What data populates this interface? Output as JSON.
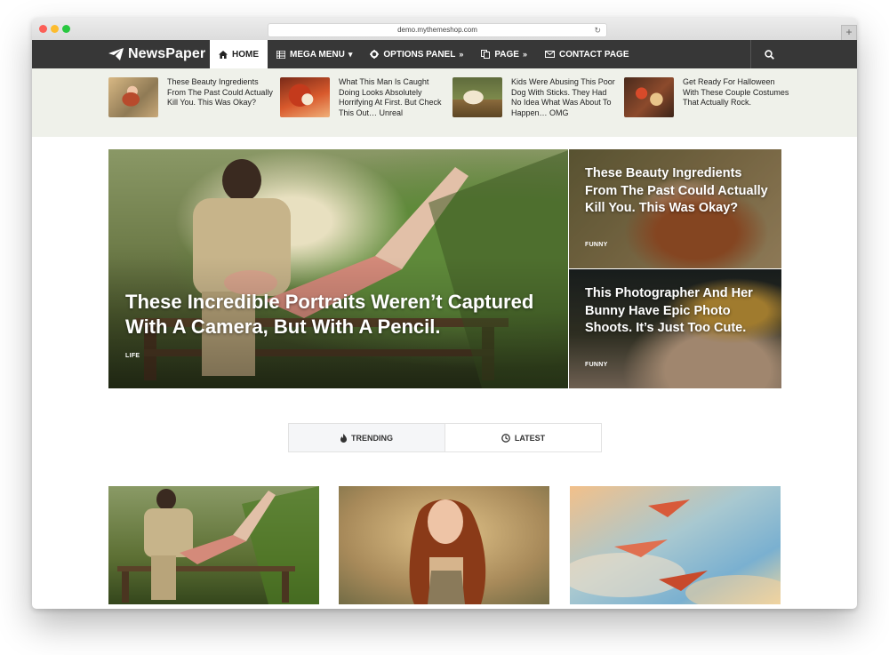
{
  "browser": {
    "url": "demo.mythemeshop.com",
    "new_tab_label": "+"
  },
  "site": {
    "logo_text": "NewsPaper",
    "nav": [
      {
        "label": "HOME",
        "icon": "home-icon",
        "active": true,
        "suffix": ""
      },
      {
        "label": "MEGA MENU",
        "icon": "grid-icon",
        "active": false,
        "suffix": "▾"
      },
      {
        "label": "OPTIONS PANEL",
        "icon": "gear-icon",
        "active": false,
        "suffix": "»"
      },
      {
        "label": "PAGE",
        "icon": "copy-icon",
        "active": false,
        "suffix": "»"
      },
      {
        "label": "CONTACT PAGE",
        "icon": "envelope-icon",
        "active": false,
        "suffix": ""
      }
    ],
    "search_icon": "search-icon"
  },
  "ticker": [
    {
      "title": "These Beauty Ingredients From The Past Could Actually Kill You. This Was Okay?"
    },
    {
      "title": "What This Man Is Caught Doing Looks Absolutely Horrifying At First. But Check This Out… Unreal"
    },
    {
      "title": "Kids Were Abusing This Poor Dog With Sticks. They Had No Idea What Was About To Happen… OMG"
    },
    {
      "title": "Get Ready For Halloween With These Couple Costumes That Actually Rock."
    }
  ],
  "hero": {
    "main": {
      "title": "These Incredible Portraits Weren’t Captured With A Camera, But With A Pencil.",
      "category": "LIFE"
    },
    "side": [
      {
        "title": "These Beauty Ingredients From The Past Could Actually Kill You. This Was Okay?",
        "category": "FUNNY"
      },
      {
        "title": "This Photographer And Her Bunny Have Epic Photo Shoots. It’s Just Too Cute.",
        "category": "FUNNY"
      }
    ]
  },
  "tabs": [
    {
      "label": "TRENDING",
      "icon": "flame-icon",
      "active": true
    },
    {
      "label": "LATEST",
      "icon": "clock-icon",
      "active": false
    }
  ],
  "colors": {
    "navbar": "#373737",
    "ticker_bg": "#eff1ea",
    "accent_white": "#ffffff"
  }
}
